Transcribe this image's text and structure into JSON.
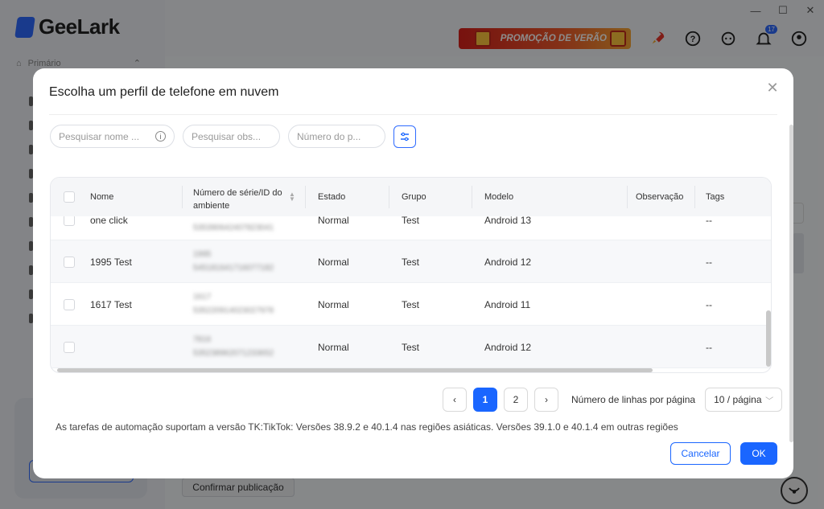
{
  "app": {
    "logo_text": "GeeLark",
    "nav_primary_label": "Primário",
    "promo_label": "PROMOÇÃO DE VERÃO",
    "notification_count": "17",
    "confirm_publish_label": "Confirmar publicação",
    "colors": {
      "accent": "#1a66ff",
      "promo": "#e0331e"
    }
  },
  "modal": {
    "title": "Escolha um perfil de telefone em nuvem",
    "filters": {
      "search_name_placeholder": "Pesquisar nome ...",
      "search_obs_placeholder": "Pesquisar obs...",
      "phone_number_placeholder": "Número do p..."
    },
    "table": {
      "headers": {
        "name": "Nome",
        "serial": "Número de série/ID do ambiente",
        "status": "Estado",
        "group": "Grupo",
        "model": "Modelo",
        "observation": "Observação",
        "tags": "Tags"
      },
      "rows": [
        {
          "name": "one click",
          "serial_a": "",
          "serial_b": "535390642407823041",
          "status": "Normal",
          "group": "Test",
          "model": "Android 13",
          "observation": "",
          "tags": "--"
        },
        {
          "name": "1995 Test",
          "serial_a": "1995",
          "serial_b": "545181641716077182",
          "status": "Normal",
          "group": "Test",
          "model": "Android 12",
          "observation": "",
          "tags": "--"
        },
        {
          "name": "1617 Test",
          "serial_a": "1617",
          "serial_b": "535220914023027978",
          "status": "Normal",
          "group": "Test",
          "model": "Android 11",
          "observation": "",
          "tags": "--"
        },
        {
          "name": "",
          "serial_a": "7816",
          "serial_b": "535238962071233652",
          "status": "Normal",
          "group": "Test",
          "model": "Android 12",
          "observation": "",
          "tags": "--"
        }
      ]
    },
    "pagination": {
      "prev": "‹",
      "pages": [
        "1",
        "2"
      ],
      "current_page": "1",
      "next": "›",
      "rows_per_page_label": "Número de linhas por página",
      "page_size": "10 / página"
    },
    "note": "As tarefas de automação suportam a versão TK:TikTok: Versões 38.9.2 e 40.1.4 nas regiões asiáticas. Versões 39.1.0 e 40.1.4 em outras regiões",
    "cancel_label": "Cancelar",
    "ok_label": "OK"
  }
}
